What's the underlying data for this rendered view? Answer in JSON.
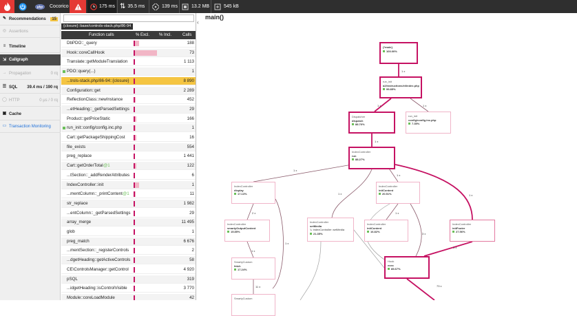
{
  "topbar": {
    "app_name": "Cocorico",
    "metrics": [
      {
        "icon": "clock-icon",
        "value": "175 ms"
      },
      {
        "icon": "arrows-icon",
        "value": "35.5 ms"
      },
      {
        "icon": "cpu-icon",
        "value": "139 ms"
      },
      {
        "icon": "memory-icon",
        "value": "13.2 MB"
      },
      {
        "icon": "network-icon",
        "value": "545 kB"
      }
    ]
  },
  "sidebar": {
    "items": [
      {
        "label": "Recommendations",
        "badge": "15"
      },
      {
        "label": "Assertions"
      },
      {
        "label": "Timeline"
      },
      {
        "label": "Callgraph"
      },
      {
        "label": "Propagation",
        "value": "0 rq"
      },
      {
        "label": "SQL",
        "value": "39.4 ms / 190 rq"
      },
      {
        "label": "HTTP",
        "value": "0 µs / 0 rq"
      },
      {
        "label": "Cache"
      },
      {
        "label": "Transaction Monitoring"
      }
    ]
  },
  "fnpanel": {
    "tooltip": "{closure}::base/controls-stack.php/86-94",
    "headers": {
      "name": "Function calls",
      "excl": "% Excl.",
      "incl": "% Incl.",
      "calls": "Calls"
    },
    "rows": [
      {
        "name": "DbPDO::_query",
        "calls": "188",
        "excl": 0.05,
        "incl": 0.2
      },
      {
        "name": "Hook::coreCallHook",
        "calls": "73",
        "excl": 0.02,
        "incl": 0.85
      },
      {
        "name": "Translate::getModuleTranslation",
        "calls": "1 113",
        "excl": 0.02,
        "incl": 0.05
      },
      {
        "name": "PDO::query(...)",
        "calls": "1",
        "excl": 0.02,
        "incl": 0.03,
        "dot": true
      },
      {
        "name": "...trols-stack.php/86-94::{closure}",
        "calls": "8 890",
        "excl": 0.02,
        "incl": 0.03,
        "selected": true
      },
      {
        "name": "Configuration::get",
        "calls": "2 289",
        "excl": 0.02,
        "incl": 0.06
      },
      {
        "name": "ReflectionClass::newInstance",
        "calls": "452",
        "excl": 0.02,
        "incl": 0.08
      },
      {
        "name": "...etHeading::_getParsedSettings",
        "calls": "29",
        "excl": 0.01,
        "incl": 0.03
      },
      {
        "name": "Product::getPriceStatic",
        "calls": "166",
        "excl": 0.01,
        "incl": 0.1
      },
      {
        "name": "run_init::config/config.inc.php",
        "calls": "1",
        "excl": 0.01,
        "incl": 0.07,
        "dot": true
      },
      {
        "name": "Cart::getPackageShippingCost",
        "calls": "16",
        "excl": 0.01,
        "incl": 0.09
      },
      {
        "name": "file_exists",
        "calls": "554",
        "excl": 0.01,
        "incl": 0.01
      },
      {
        "name": "preg_replace",
        "calls": "1 441",
        "excl": 0.01,
        "incl": 0.01
      },
      {
        "name": "Cart::getOrderTotal",
        "suffix": "@1",
        "calls": "122",
        "excl": 0.01,
        "incl": 0.09
      },
      {
        "name": "...tSection::_addRenderAttributes",
        "calls": "6",
        "excl": 0.01,
        "incl": 0.02
      },
      {
        "name": "IndexController::init",
        "calls": "1",
        "excl": 0.01,
        "incl": 0.2
      },
      {
        "name": "...mentColumn::_printContent",
        "suffix": "@1",
        "calls": "11",
        "excl": 0.01,
        "incl": 0.08
      },
      {
        "name": "str_replace",
        "calls": "1 982",
        "excl": 0.01,
        "incl": 0.01
      },
      {
        "name": "...entColumn::_getParsedSettings",
        "calls": "29",
        "excl": 0.01,
        "incl": 0.02
      },
      {
        "name": "array_merge",
        "calls": "11 495",
        "excl": 0.01,
        "incl": 0.01
      },
      {
        "name": "glob",
        "calls": "1",
        "excl": 0.01,
        "incl": 0.01
      },
      {
        "name": "preg_match",
        "calls": "6 676",
        "excl": 0.01,
        "incl": 0.01
      },
      {
        "name": "...mentSection::_registerControls",
        "calls": "2",
        "excl": 0.01,
        "incl": 0.02
      },
      {
        "name": "...dgetHeading::getActiveControls",
        "calls": "58",
        "excl": 0.01,
        "incl": 0.02
      },
      {
        "name": "CE\\ControlsManager::getControl",
        "calls": "4 920",
        "excl": 0.01,
        "incl": 0.01
      },
      {
        "name": "pSQL",
        "calls": "319",
        "excl": 0.01,
        "incl": 0.02
      },
      {
        "name": "...idgetHeading::isControlVisible",
        "calls": "3 770",
        "excl": 0.01,
        "incl": 0.01
      },
      {
        "name": "Module::coreLoadModule",
        "calls": "42",
        "excl": 0.01,
        "incl": 0.06
      }
    ]
  },
  "graph": {
    "title": "main()",
    "nodes": [
      {
        "id": "main",
        "cls": "",
        "fn": "{*main}",
        "pct": "100.00%"
      },
      {
        "id": "index",
        "cls": "run_init",
        "fn": "a2/instructions/ei/index.php",
        "pct": "99.85%"
      },
      {
        "id": "dispatch",
        "cls": "Dispatcher",
        "fn": "dispatch",
        "pct": "88.76%"
      },
      {
        "id": "config",
        "cls": "run_init",
        "fn": "config/config.inc.php",
        "pct": "7.35%"
      },
      {
        "id": "run",
        "cls": "IndexController",
        "fn": "run",
        "pct": "88.27%"
      },
      {
        "id": "display",
        "cls": "IndexController",
        "fn": "display",
        "pct": "17.13%"
      },
      {
        "id": "initcontent",
        "cls": "IndexController",
        "fn": "initContent",
        "pct": "20.51%"
      },
      {
        "id": "smartyout",
        "cls": "IndexController",
        "fn": "smartyOutputContent",
        "pct": "15.85%"
      },
      {
        "id": "setmedia",
        "cls": "IndexController",
        "fn": "setMedia",
        "pct": "21.35%",
        "extra": "↳ IndexController::setMedia"
      },
      {
        "id": "initcontent2",
        "cls": "IndexController",
        "fn": "initContent",
        "pct": "16.82%"
      },
      {
        "id": "initfooter",
        "cls": "IndexController",
        "fn": "initFooter",
        "pct": "27.56%"
      },
      {
        "id": "fetch",
        "cls": "SmartyCustom",
        "fn": "fetch",
        "pct": "17.24%"
      },
      {
        "id": "hookexec",
        "cls": "Hook",
        "fn": "exec",
        "pct": "85.67%"
      },
      {
        "id": "smarty2",
        "cls": "SmartyCustom",
        "fn": "",
        "pct": ""
      }
    ],
    "edges": [
      "1 x",
      "1 x",
      "1 x",
      "1 x",
      "1 x",
      "1 x",
      "1 x",
      "1 x",
      "2 x",
      "1 x",
      "1 x",
      "1 x",
      "3 x",
      "3 x",
      "11 x",
      "73 x"
    ]
  },
  "colors": {
    "hot": "#c51162",
    "light": "#f0b4c8",
    "selected": "#f5c542",
    "topbar": "#2f2f2f"
  }
}
